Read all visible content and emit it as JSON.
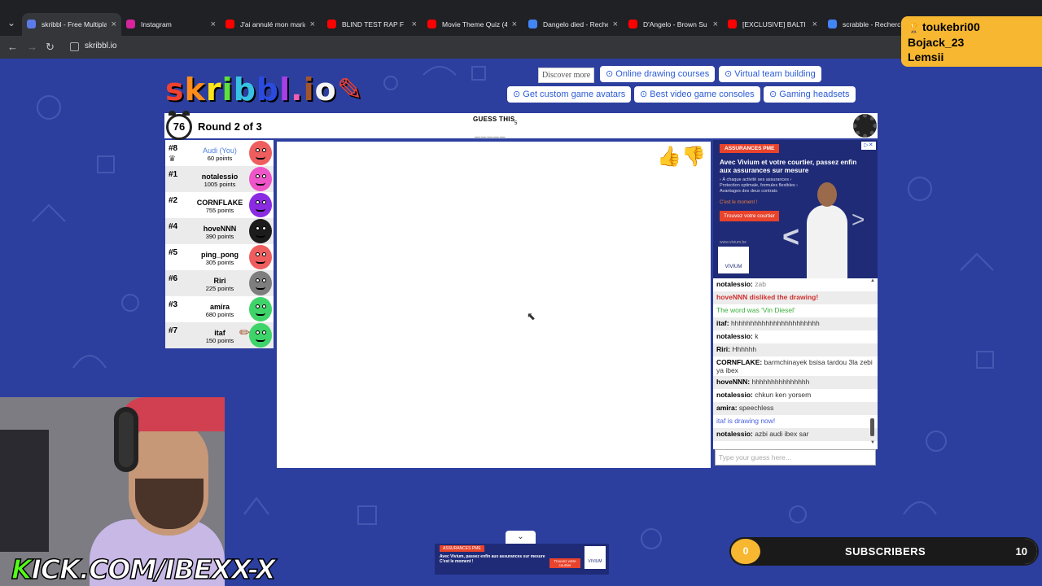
{
  "browser": {
    "tabs": [
      {
        "title": "skribbl - Free Multipla",
        "active": true,
        "icon_color": "#5b7be8"
      },
      {
        "title": "Instagram",
        "active": false,
        "icon_color": "#d6249f"
      },
      {
        "title": "J'ai annulé mon mariag",
        "active": false,
        "icon_color": "#ff0000"
      },
      {
        "title": "BLIND TEST RAP F",
        "active": false,
        "icon_color": "#ff0000"
      },
      {
        "title": "Movie Theme Quiz (4",
        "active": false,
        "icon_color": "#ff0000"
      },
      {
        "title": "Dangelo died - Reche",
        "active": false,
        "icon_color": "#4285f4"
      },
      {
        "title": "D'Angelo - Brown Su",
        "active": false,
        "icon_color": "#ff0000"
      },
      {
        "title": "[EXCLUSIVE] BALTI &",
        "active": false,
        "icon_color": "#ff0000"
      },
      {
        "title": "scrabble - Recherche",
        "active": false,
        "icon_color": "#4285f4"
      }
    ],
    "close_glyph": "×",
    "tab_dropdown": "⌄",
    "back": "←",
    "forward": "→",
    "reload": "↻",
    "url": "skribbl.io"
  },
  "logo": {
    "parts": [
      "s",
      "k",
      "r",
      "i",
      "b",
      "b",
      "l",
      ".",
      "i",
      "o",
      "✎"
    ]
  },
  "ads_top": {
    "discover": "Discover more",
    "links": [
      "⊙ Online drawing courses",
      "⊙ Virtual team building",
      "⊙ Get custom game avatars",
      "⊙ Best video game consoles",
      "⊙ Gaming headsets"
    ]
  },
  "game": {
    "timer": "76",
    "round": "Round 2 of 3",
    "guess_label": "GUESS THIS",
    "word_hint": "_____",
    "word_length": "5"
  },
  "players": [
    {
      "rank": "#8",
      "name": "Audi (You)",
      "points": "60 points",
      "you": true,
      "color": "#ef5e5e",
      "crown": true
    },
    {
      "rank": "#1",
      "name": "notalessio",
      "points": "1005 points",
      "you": false,
      "color": "#ee55c8"
    },
    {
      "rank": "#2",
      "name": "CORNFLAKE",
      "points": "755 points",
      "you": false,
      "color": "#8a2be2"
    },
    {
      "rank": "#4",
      "name": "hoveNNN",
      "points": "390 points",
      "you": false,
      "color": "#1c1c1c"
    },
    {
      "rank": "#5",
      "name": "ping_pong",
      "points": "305 points",
      "you": false,
      "color": "#ef5e5e"
    },
    {
      "rank": "#6",
      "name": "Riri",
      "points": "225 points",
      "you": false,
      "color": "#7e7e7e"
    },
    {
      "rank": "#3",
      "name": "amira",
      "points": "680 points",
      "you": false,
      "color": "#3fd46a"
    },
    {
      "rank": "#7",
      "name": "itaf",
      "points": "150 points",
      "you": false,
      "color": "#3fd46a",
      "drawing": true
    }
  ],
  "ad": {
    "tag": "ASSURANCES PME",
    "title": "Avec Vivium et votre courtier, passez enfin aux assurances sur mesure",
    "bullets": "› À chaque activité ses assurances › Protection optimale, formules flexibles › Avantages des deux contrats",
    "moment": "C'est le moment !",
    "cta": "Trouvez votre courtier",
    "site": "www.vivium.be",
    "logo": "VIVIUM"
  },
  "chat": {
    "messages": [
      {
        "author": "notalessio",
        "text": "zab",
        "style": "faded",
        "alt": false
      },
      {
        "author": "",
        "text": "hoveNNN disliked the drawing!",
        "style": "sys-red",
        "alt": true
      },
      {
        "author": "",
        "text": "The word was 'Vin Diesel'",
        "style": "sys-green",
        "alt": false
      },
      {
        "author": "itaf",
        "text": "hhhhhhhhhhhhhhhhhhhhhhh",
        "style": "",
        "alt": true
      },
      {
        "author": "notalessio",
        "text": "k",
        "style": "",
        "alt": false
      },
      {
        "author": "Riri",
        "text": "Hhhhhh",
        "style": "",
        "alt": true
      },
      {
        "author": "CORNFLAKE",
        "text": "barmchinayek bsisa tardou 3la zebi ya ibex",
        "style": "",
        "alt": false
      },
      {
        "author": "hoveNNN",
        "text": "hhhhhhhhhhhhhhh",
        "style": "",
        "alt": true
      },
      {
        "author": "notalessio",
        "text": "chkun ken yorsem",
        "style": "",
        "alt": false
      },
      {
        "author": "amira",
        "text": "speechless",
        "style": "",
        "alt": true
      },
      {
        "author": "",
        "text": "itaf is drawing now!",
        "style": "sys-blue",
        "alt": false
      },
      {
        "author": "notalessio",
        "text": "azbi audi ibex sar",
        "style": "",
        "alt": true
      }
    ],
    "placeholder": "Type your guess here..."
  },
  "bottom_ad": {
    "tag": "ASSURANCES PME",
    "text": "Avec Vivium, passez enfin aux assurances sur mesure C'est le moment !",
    "cta": "Trouvez votre courtier",
    "logo": "VIVIUM",
    "collapse": "⌄"
  },
  "stream": {
    "channel": "KICK.COM/IBEXX-X",
    "sub_current": "0",
    "sub_label": "SUBSCRIBERS",
    "sub_goal": "10",
    "sub_progress": 0.0,
    "top_list": [
      "toukebri00",
      "Bojack_23",
      "Lemsii"
    ]
  },
  "colors": {
    "page_bg": "#2c3f9f",
    "accent_yellow": "#f7b731",
    "kick_green": "#53fc18"
  }
}
